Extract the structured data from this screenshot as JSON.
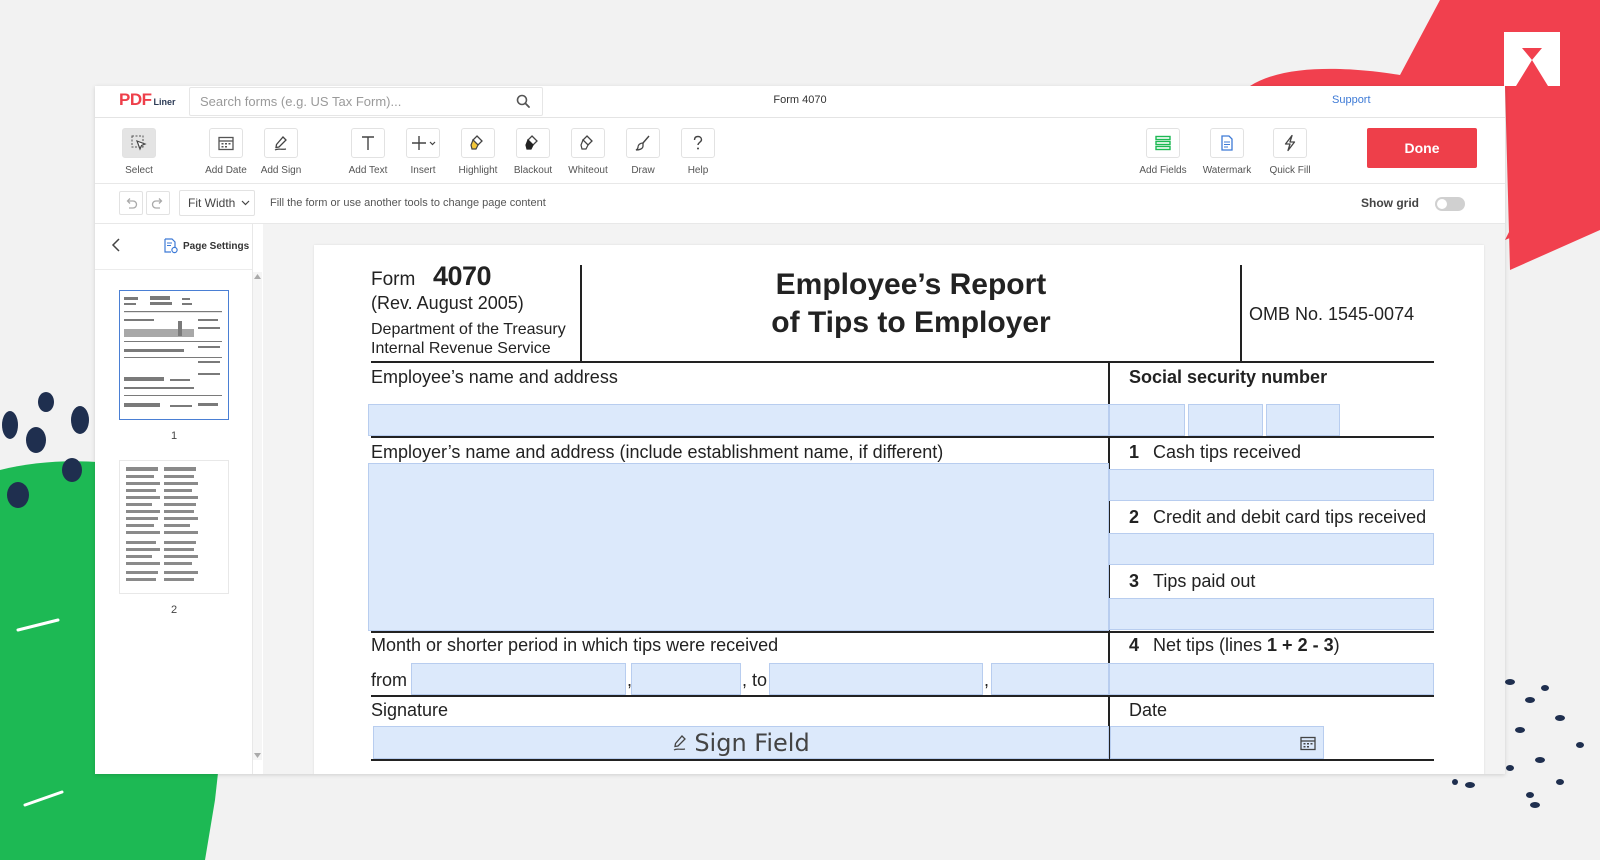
{
  "app": {
    "logo_pdf": "PDF",
    "logo_liner": "Liner",
    "search_placeholder": "Search forms (e.g. US Tax Form)...",
    "document_title": "Form 4070",
    "support_label": "Support",
    "done_label": "Done"
  },
  "toolbar": {
    "tools": [
      {
        "label": "Select",
        "icon": "select-cursor-icon"
      },
      {
        "label": "Add Date",
        "icon": "calendar-icon"
      },
      {
        "label": "Add Sign",
        "icon": "pen-sign-icon"
      },
      {
        "label": "Add Text",
        "icon": "text-icon"
      },
      {
        "label": "Insert",
        "icon": "plus-icon"
      },
      {
        "label": "Highlight",
        "icon": "highlighter-icon"
      },
      {
        "label": "Blackout",
        "icon": "blackout-brush-icon"
      },
      {
        "label": "Whiteout",
        "icon": "whiteout-brush-icon"
      },
      {
        "label": "Draw",
        "icon": "brush-icon"
      },
      {
        "label": "Help",
        "icon": "question-icon"
      },
      {
        "label": "Add Fields",
        "icon": "add-fields-icon"
      },
      {
        "label": "Watermark",
        "icon": "watermark-icon"
      },
      {
        "label": "Quick Fill",
        "icon": "lightning-icon"
      }
    ]
  },
  "subbar": {
    "zoom_label": "Fit Width",
    "hint": "Fill the form or use another tools to change page content",
    "show_grid_label": "Show grid"
  },
  "sidebar": {
    "page_settings_label": "Page Settings",
    "pages": [
      "1",
      "2"
    ]
  },
  "form": {
    "form_word": "Form",
    "form_number": "4070",
    "revision": "(Rev. August 2005)",
    "dept_line1": "Department of the Treasury",
    "dept_line2": "Internal Revenue Service",
    "title_line1": "Employee’s Report",
    "title_line2": "of Tips to Employer",
    "omb": "OMB No. 1545-0074",
    "employee_name_label": "Employee’s name and address",
    "ssn_label": "Social security number",
    "employer_label": "Employer’s name and address (include establishment name, if different)",
    "line1_num": "1",
    "line1_label": "Cash tips received",
    "line2_num": "2",
    "line2_label": "Credit and debit card tips received",
    "line3_num": "3",
    "line3_label": "Tips paid out",
    "line4_num": "4",
    "line4_label_a": "Net tips (lines ",
    "line4_label_b": "1 + 2 - 3",
    "line4_label_c": ")",
    "period_label": "Month or shorter period in which tips were received",
    "from_label": "from",
    "comma": ",",
    "to_label": ", to",
    "signature_label": "Signature",
    "sign_field_label": "Sign Field",
    "date_label": "Date"
  },
  "colors": {
    "accent": "#ee3f4a",
    "field_fill": "#dce9fb",
    "link": "#3d7ad6",
    "deco_green": "#1db954",
    "deco_navy": "#1f2f4f"
  }
}
